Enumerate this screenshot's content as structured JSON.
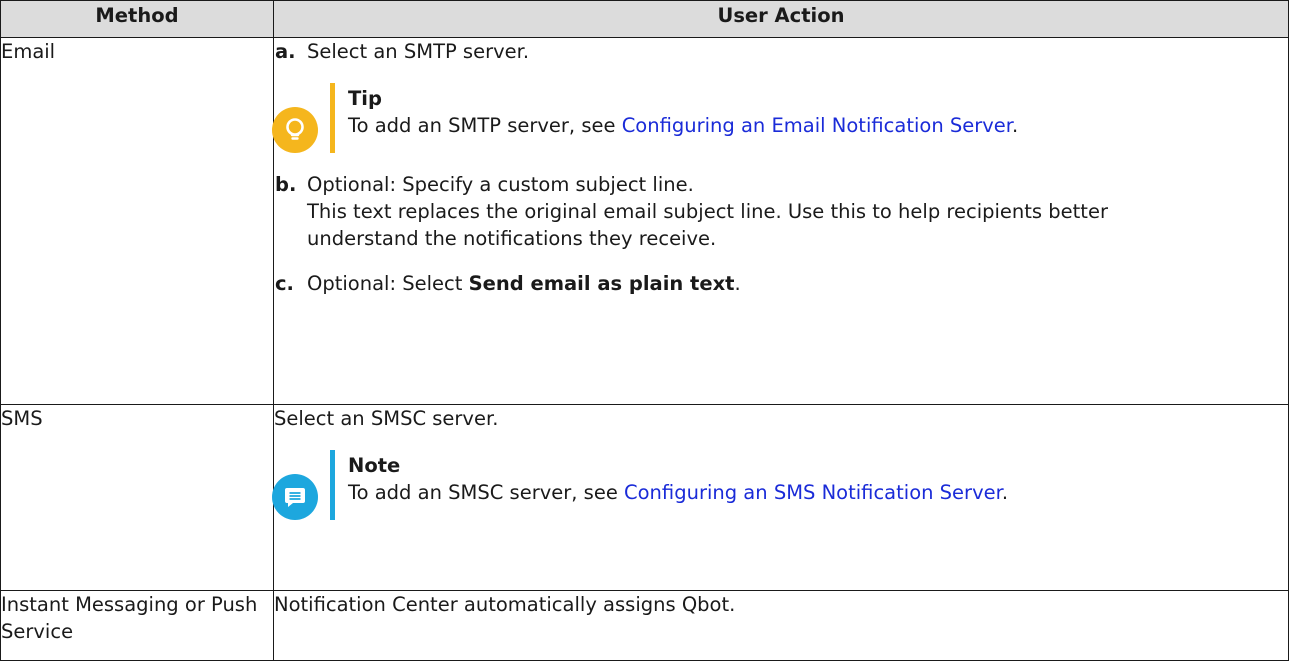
{
  "table": {
    "headers": {
      "method": "Method",
      "user_action": "User Action"
    },
    "email": {
      "method": "Email",
      "step_a": {
        "label": "a.",
        "text": "Select an SMTP server."
      },
      "tip": {
        "title": "Tip",
        "text_before": "To add an SMTP server, see ",
        "link": "Configuring an Email Notification Server",
        "text_after": "."
      },
      "step_b": {
        "label": "b.",
        "text": "Optional: Specify a custom subject line.",
        "detail": "This text replaces the original email subject line. Use this to help recipients better understand the notifications they receive."
      },
      "step_c": {
        "label": "c.",
        "text": "Optional: Select ",
        "bold": "Send email as plain text",
        "text_after": "."
      }
    },
    "sms": {
      "method": "SMS",
      "text": "Select an SMSC server.",
      "note": {
        "title": "Note",
        "text_before": "To add an SMSC server, see ",
        "link": "Configuring an SMS Notification Server",
        "text_after": "."
      }
    },
    "im": {
      "method": "Instant Messaging or Push Service",
      "text": "Notification Center automatically assigns Qbot."
    }
  },
  "colors": {
    "tip": "#f5b61d",
    "note": "#1da7de",
    "link": "#1a2bd8",
    "header_bg": "#dcdcdc"
  },
  "icons": {
    "tip": "lightbulb-icon",
    "note": "message-icon"
  }
}
